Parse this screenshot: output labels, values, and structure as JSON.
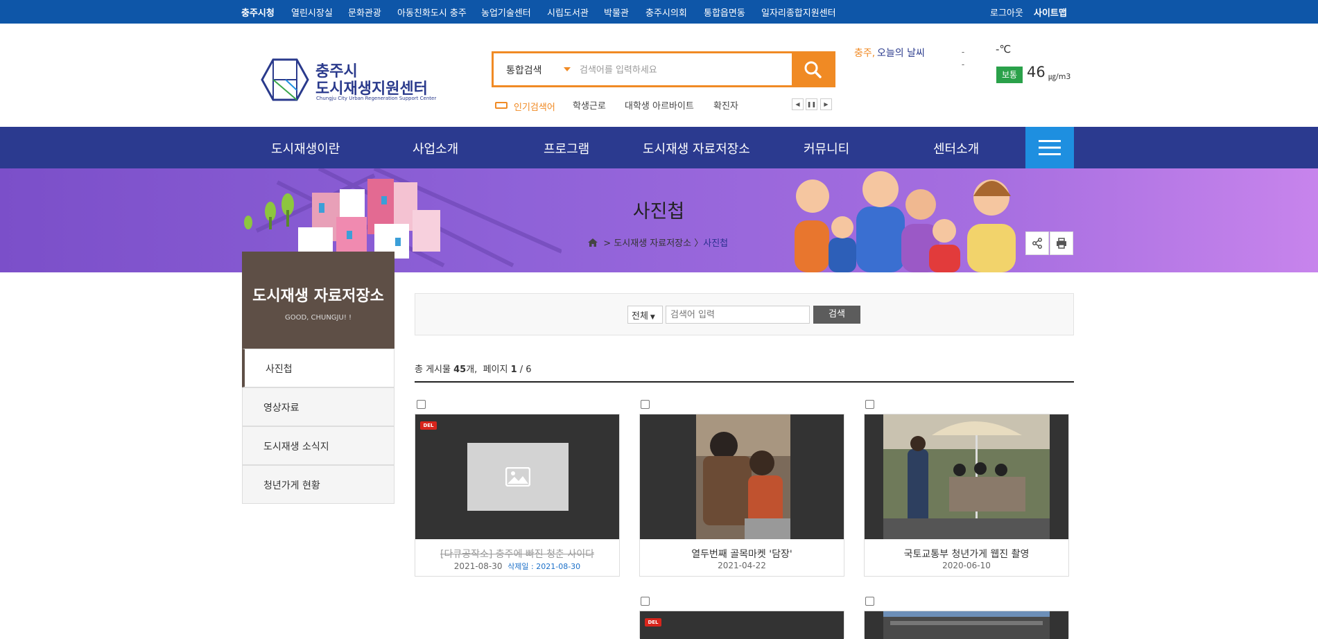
{
  "topbar": {
    "links": [
      "충주시청",
      "열린시장실",
      "문화관광",
      "아동친화도시 충주",
      "농업기술센터",
      "시립도서관",
      "박물관",
      "충주시의회",
      "통합읍면동",
      "일자리종합지원센터"
    ],
    "logout": "로그아웃",
    "sitemap": "사이트맵"
  },
  "header": {
    "logo_line1": "충주시",
    "logo_line2": "도시재생지원센터",
    "logo_sub": "Chungju City Urban Regeneration Support Center"
  },
  "search": {
    "scope": "통합검색",
    "placeholder": "검색어를 입력하세요",
    "button_icon": "search-icon",
    "popular_label": "인기검색어",
    "popular_keywords": [
      "학생근로",
      "대학생 아르바이트",
      "확진자"
    ]
  },
  "weather": {
    "city": "충주,",
    "label": "오늘의 날씨",
    "image_alt": "-",
    "image_caption": "-",
    "temp": "-℃",
    "dust_grade": "보통",
    "dust_value": "46",
    "dust_unit": "㎍/m3"
  },
  "gnb": {
    "items": [
      "도시재생이란",
      "사업소개",
      "프로그램",
      "도시재생 자료저장소",
      "커뮤니티",
      "센터소개"
    ],
    "menu_icon": "hamburger-icon"
  },
  "visual": {
    "title": "사진첩",
    "breadcrumb_parent": "도시재생 자료저장소",
    "breadcrumb_current": "사진첩"
  },
  "lnb": {
    "title": "도시재생 자료저장소",
    "subtitle": "GOOD, CHUNGJU! !",
    "items": [
      "사진첩",
      "영상자료",
      "도시재생 소식지",
      "청년가게 현황"
    ],
    "active_index": 0
  },
  "board": {
    "scope_value": "전체",
    "search_placeholder": "검색어 입력",
    "search_button": "검색",
    "count_prefix": "총 게시물",
    "count_value": "45",
    "count_suffix": "개,",
    "page_prefix": "페이지",
    "page_current": "1",
    "page_total": "/ 6",
    "cards": [
      {
        "title": "[다큐공작소] 충주에 빠진 청춘 사이다",
        "date": "2021-08-30",
        "deleted": true,
        "del_badge": "DEL",
        "del_date": "삭제일 : 2021-08-30"
      },
      {
        "title": "열두번째 골목마켓 '담장'",
        "date": "2021-04-22",
        "deleted": false
      },
      {
        "title": "국토교통부 청년가게 웹진 촬영",
        "date": "2020-06-10",
        "deleted": false
      }
    ],
    "next_row_badge": "DEL"
  },
  "colors": {
    "topbar": "#0e56a8",
    "gnb": "#2b3a8f",
    "accent_orange": "#f08a24",
    "menu_button": "#1e8fe0",
    "lnb_head": "#5e4f46",
    "dust_good": "#2aa14a",
    "del_badge": "#d8251c"
  }
}
